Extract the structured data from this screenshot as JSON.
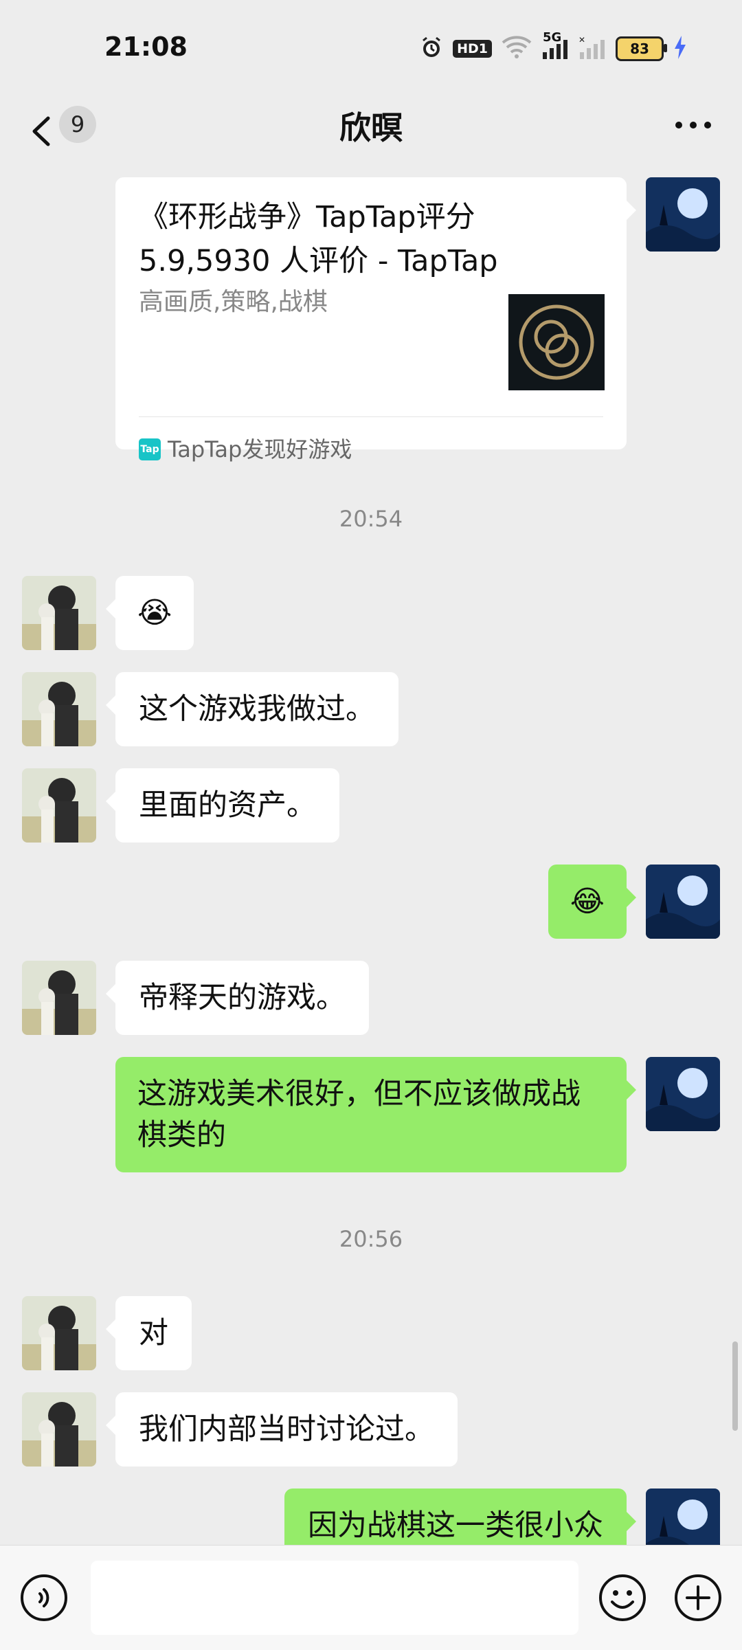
{
  "status_bar": {
    "time": "21:08",
    "hd_label": "HD1",
    "network_label": "5G",
    "battery": "83"
  },
  "header": {
    "unread_count": "9",
    "title": "欣暝"
  },
  "card": {
    "title": "《环形战争》TapTap评分 5.9,5930 人评价 - TapTap",
    "description": "高画质,策略,战棋",
    "source_logo": "Tap",
    "source": "TapTap发现好游戏"
  },
  "timestamps": [
    "20:54",
    "20:56"
  ],
  "messages": [
    {
      "side": "left",
      "text": "😭"
    },
    {
      "side": "left",
      "text": "这个游戏我做过。"
    },
    {
      "side": "left",
      "text": "里面的资产。"
    },
    {
      "side": "right",
      "text": "😂"
    },
    {
      "side": "left",
      "text": "帝释天的游戏。"
    },
    {
      "side": "right",
      "text": "这游戏美术很好，但不应该做成战棋类的"
    },
    {
      "side": "left",
      "text": "对"
    },
    {
      "side": "left",
      "text": "我们内部当时讨论过。"
    },
    {
      "side": "right",
      "text": "因为战棋这一类很小众"
    }
  ],
  "input": {
    "value": "",
    "placeholder": ""
  },
  "colors": {
    "background": "#ededed",
    "bubble_sent": "#95ec69",
    "bubble_received": "#ffffff"
  }
}
